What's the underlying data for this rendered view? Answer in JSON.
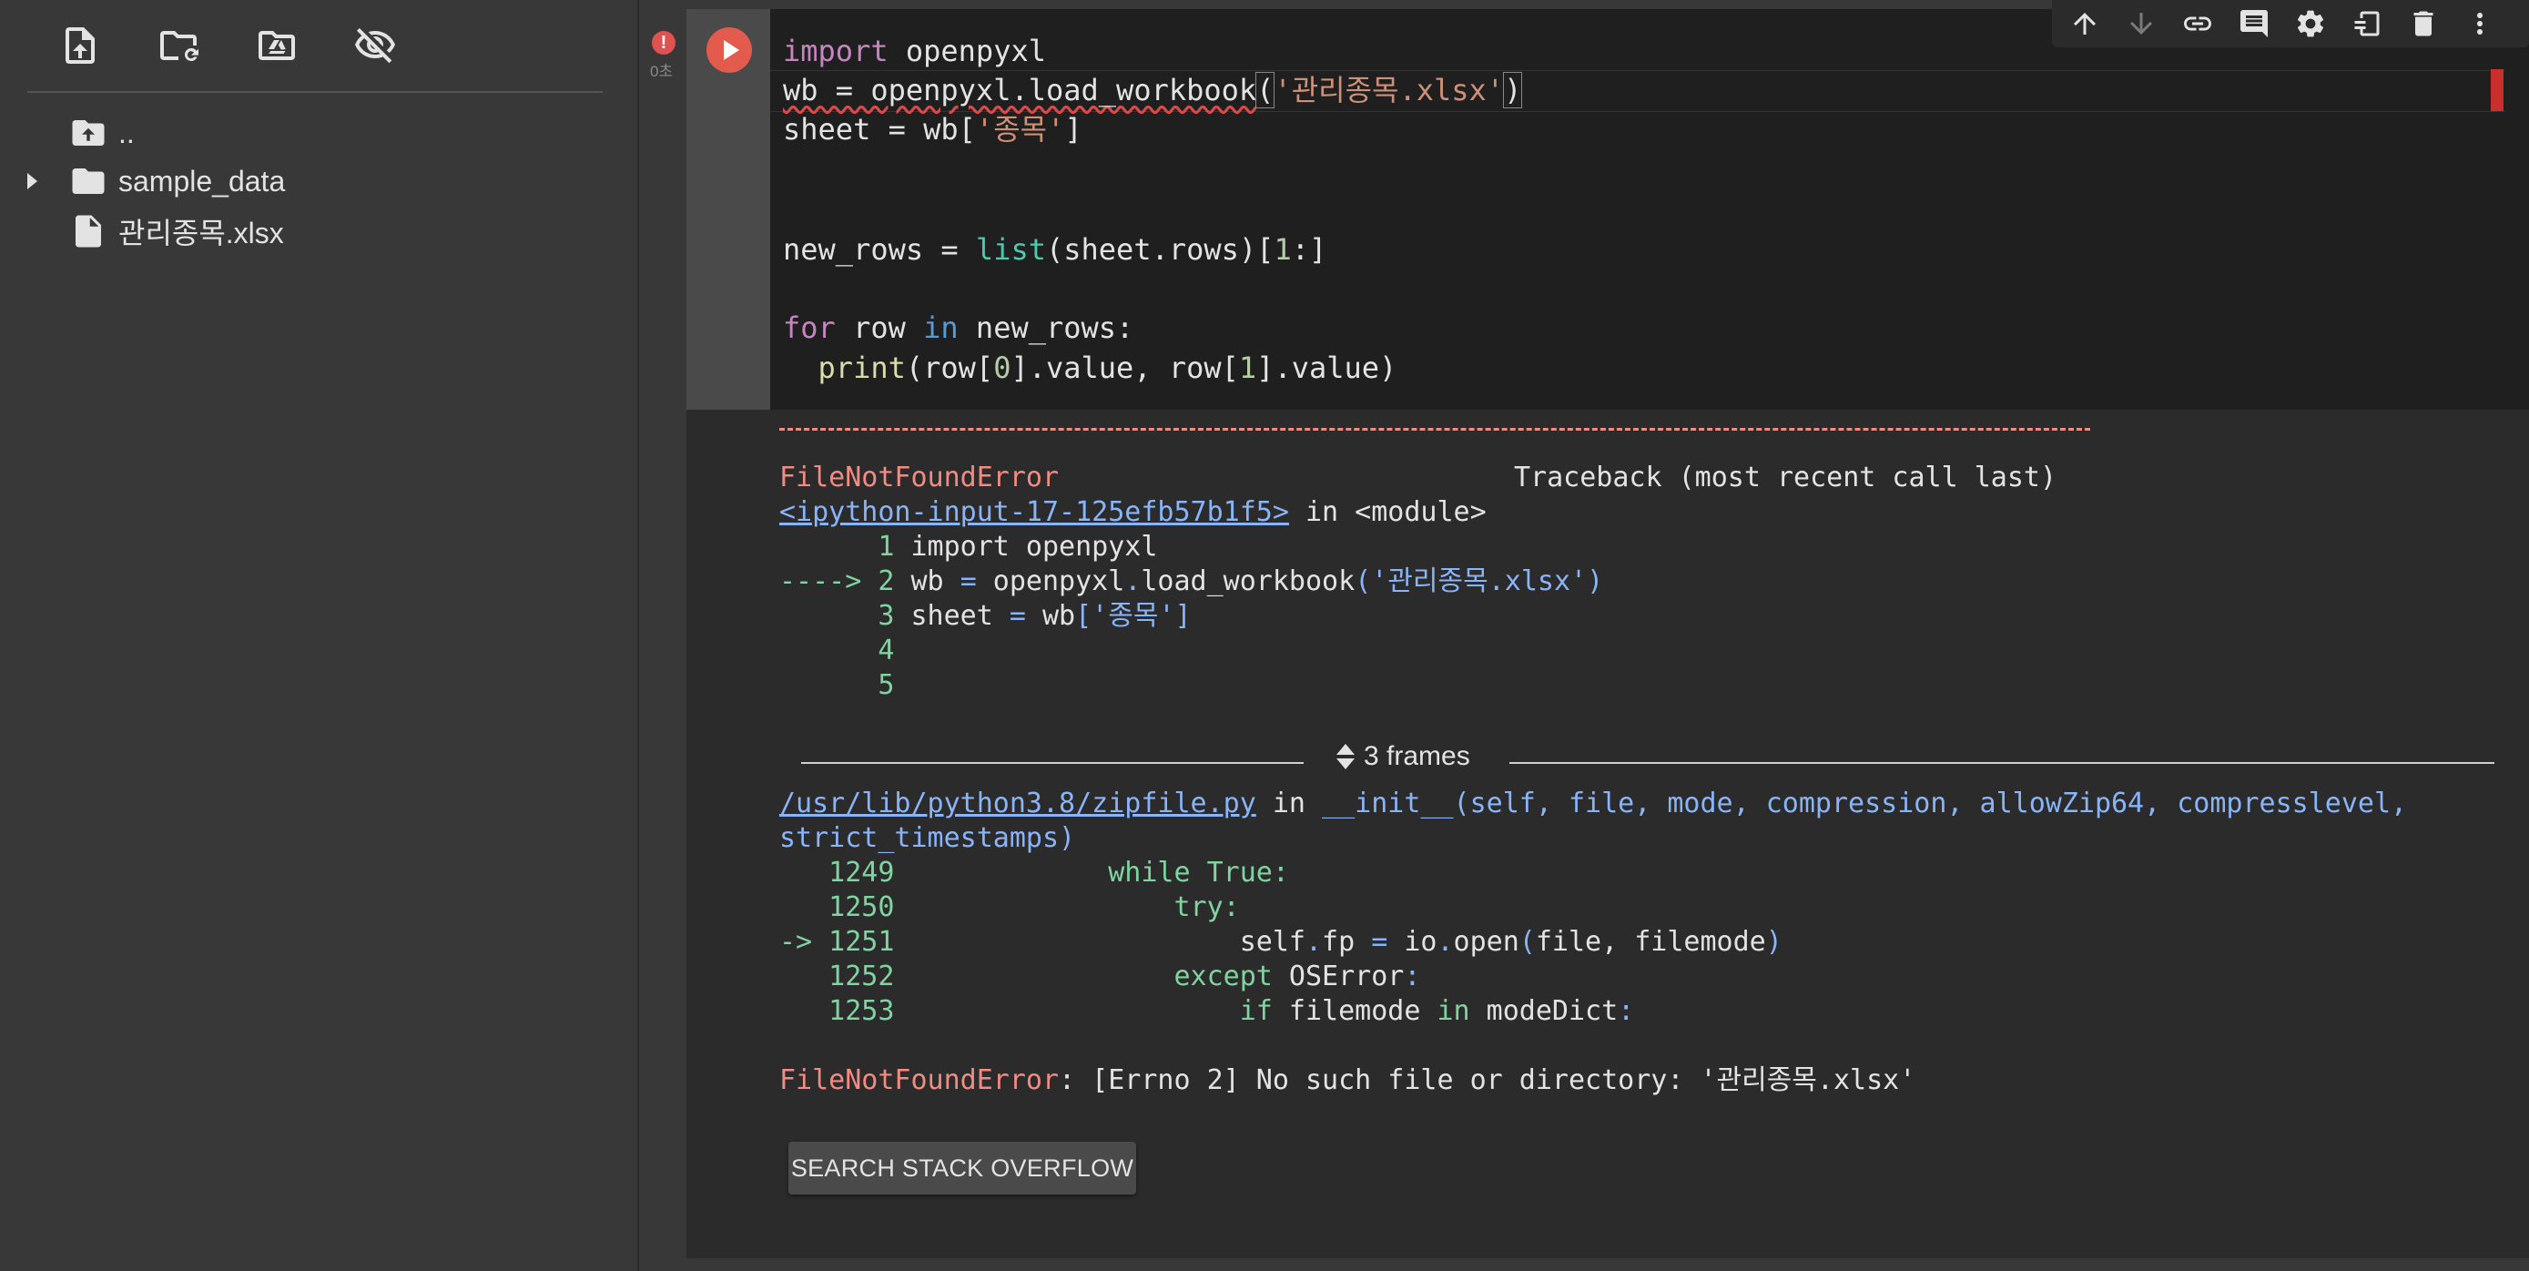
{
  "sidebar": {
    "toolbar": [
      {
        "name": "upload-file-button",
        "icon": "upload-file-icon"
      },
      {
        "name": "refresh-folder-button",
        "icon": "folder-refresh-icon"
      },
      {
        "name": "mount-drive-button",
        "icon": "drive-folder-icon"
      },
      {
        "name": "toggle-hidden-files-button",
        "icon": "eye-off-icon"
      }
    ],
    "tree": {
      "parent": "..",
      "folder": "sample_data",
      "file": "관리종목.xlsx"
    }
  },
  "cell": {
    "exec_time": "0초",
    "status_icon": "error-icon",
    "code": {
      "l1_kw": "import",
      "l1_rest": " openpyxl",
      "l2_a": "wb = openpyxl.load_workbook",
      "l2_open": "(",
      "l2_str": "'관리종목.xlsx'",
      "l2_close": ")",
      "l3_a": "sheet = wb[",
      "l3_str": "'종목'",
      "l3_b": "]",
      "l6_a": "new_rows = ",
      "l6_fn": "list",
      "l6_b": "(sheet.rows)[",
      "l6_num": "1",
      "l6_c": ":]",
      "l8_for": "for",
      "l8_a": " row ",
      "l8_in": "in",
      "l8_b": " new_rows:",
      "l9_indent": "  ",
      "l9_fn": "print",
      "l9_a": "(row[",
      "l9_n0": "0",
      "l9_b": "].value, row[",
      "l9_n1": "1",
      "l9_c": "].value)"
    },
    "toolbar": [
      {
        "name": "move-cell-up-button",
        "icon": "arrow-up-icon",
        "enabled": true
      },
      {
        "name": "move-cell-down-button",
        "icon": "arrow-down-icon",
        "enabled": false
      },
      {
        "name": "copy-link-button",
        "icon": "link-icon",
        "enabled": true
      },
      {
        "name": "add-comment-button",
        "icon": "comment-icon",
        "enabled": true
      },
      {
        "name": "cell-settings-button",
        "icon": "gear-icon",
        "enabled": true
      },
      {
        "name": "mirror-cell-button",
        "icon": "mirror-tab-icon",
        "enabled": true
      },
      {
        "name": "delete-cell-button",
        "icon": "trash-icon",
        "enabled": true
      },
      {
        "name": "more-actions-button",
        "icon": "more-vert-icon",
        "enabled": true
      }
    ]
  },
  "output": {
    "error_name": "FileNotFoundError",
    "traceback_header": "Traceback (most recent call last)",
    "input_link": "<ipython-input-17-125efb57b1f5>",
    "in_module": " in <module>",
    "tb1": {
      "l1_no": "      1 ",
      "l1_code": "import openpyxl",
      "l2_arrow": "----> 2 ",
      "l2_a": "wb ",
      "l2_eq": "=",
      "l2_b": " openpyxl",
      "l2_dot": ".",
      "l2_c": "load_workbook",
      "l2_str": "('관리종목.xlsx')",
      "l3_no": "      3 ",
      "l3_a": "sheet ",
      "l3_eq": "=",
      "l3_b": " wb",
      "l3_str": "['종목']",
      "l4_no": "      4",
      "l5_no": "      5"
    },
    "frames_label": "3 frames",
    "zip_link": "/usr/lib/python3.8/zipfile.py",
    "zip_in": " in ",
    "zip_sig": "__init__(self, file, mode, compression, allowZip64, compresslevel,",
    "zip_sig2": "strict_timestamps)",
    "tb2": {
      "n1249": "   1249 ",
      "c1249_kw": "            while True:",
      "n1250": "   1250 ",
      "c1250_kw": "                try:",
      "n1251": "-> 1251 ",
      "c1251_a": "                    self",
      "c1251_dot": ".",
      "c1251_b": "fp ",
      "c1251_eq": "=",
      "c1251_c": " io",
      "c1251_dot2": ".",
      "c1251_d": "open",
      "c1251_p1": "(",
      "c1251_e": "file, filemode",
      "c1251_p2": ")",
      "n1252": "   1252 ",
      "c1252_kw": "                except",
      "c1252_b": " OSError",
      "c1252_c": ":",
      "n1253": "   1253 ",
      "c1253_kw": "                    if",
      "c1253_b": " filemode ",
      "c1253_in": "in",
      "c1253_c": " modeDict",
      "c1253_d": ":"
    },
    "final_error_name": "FileNotFoundError",
    "final_error_msg": ": [Errno 2] No such file or directory: '관리종목.xlsx'",
    "so_button": "SEARCH STACK OVERFLOW"
  }
}
